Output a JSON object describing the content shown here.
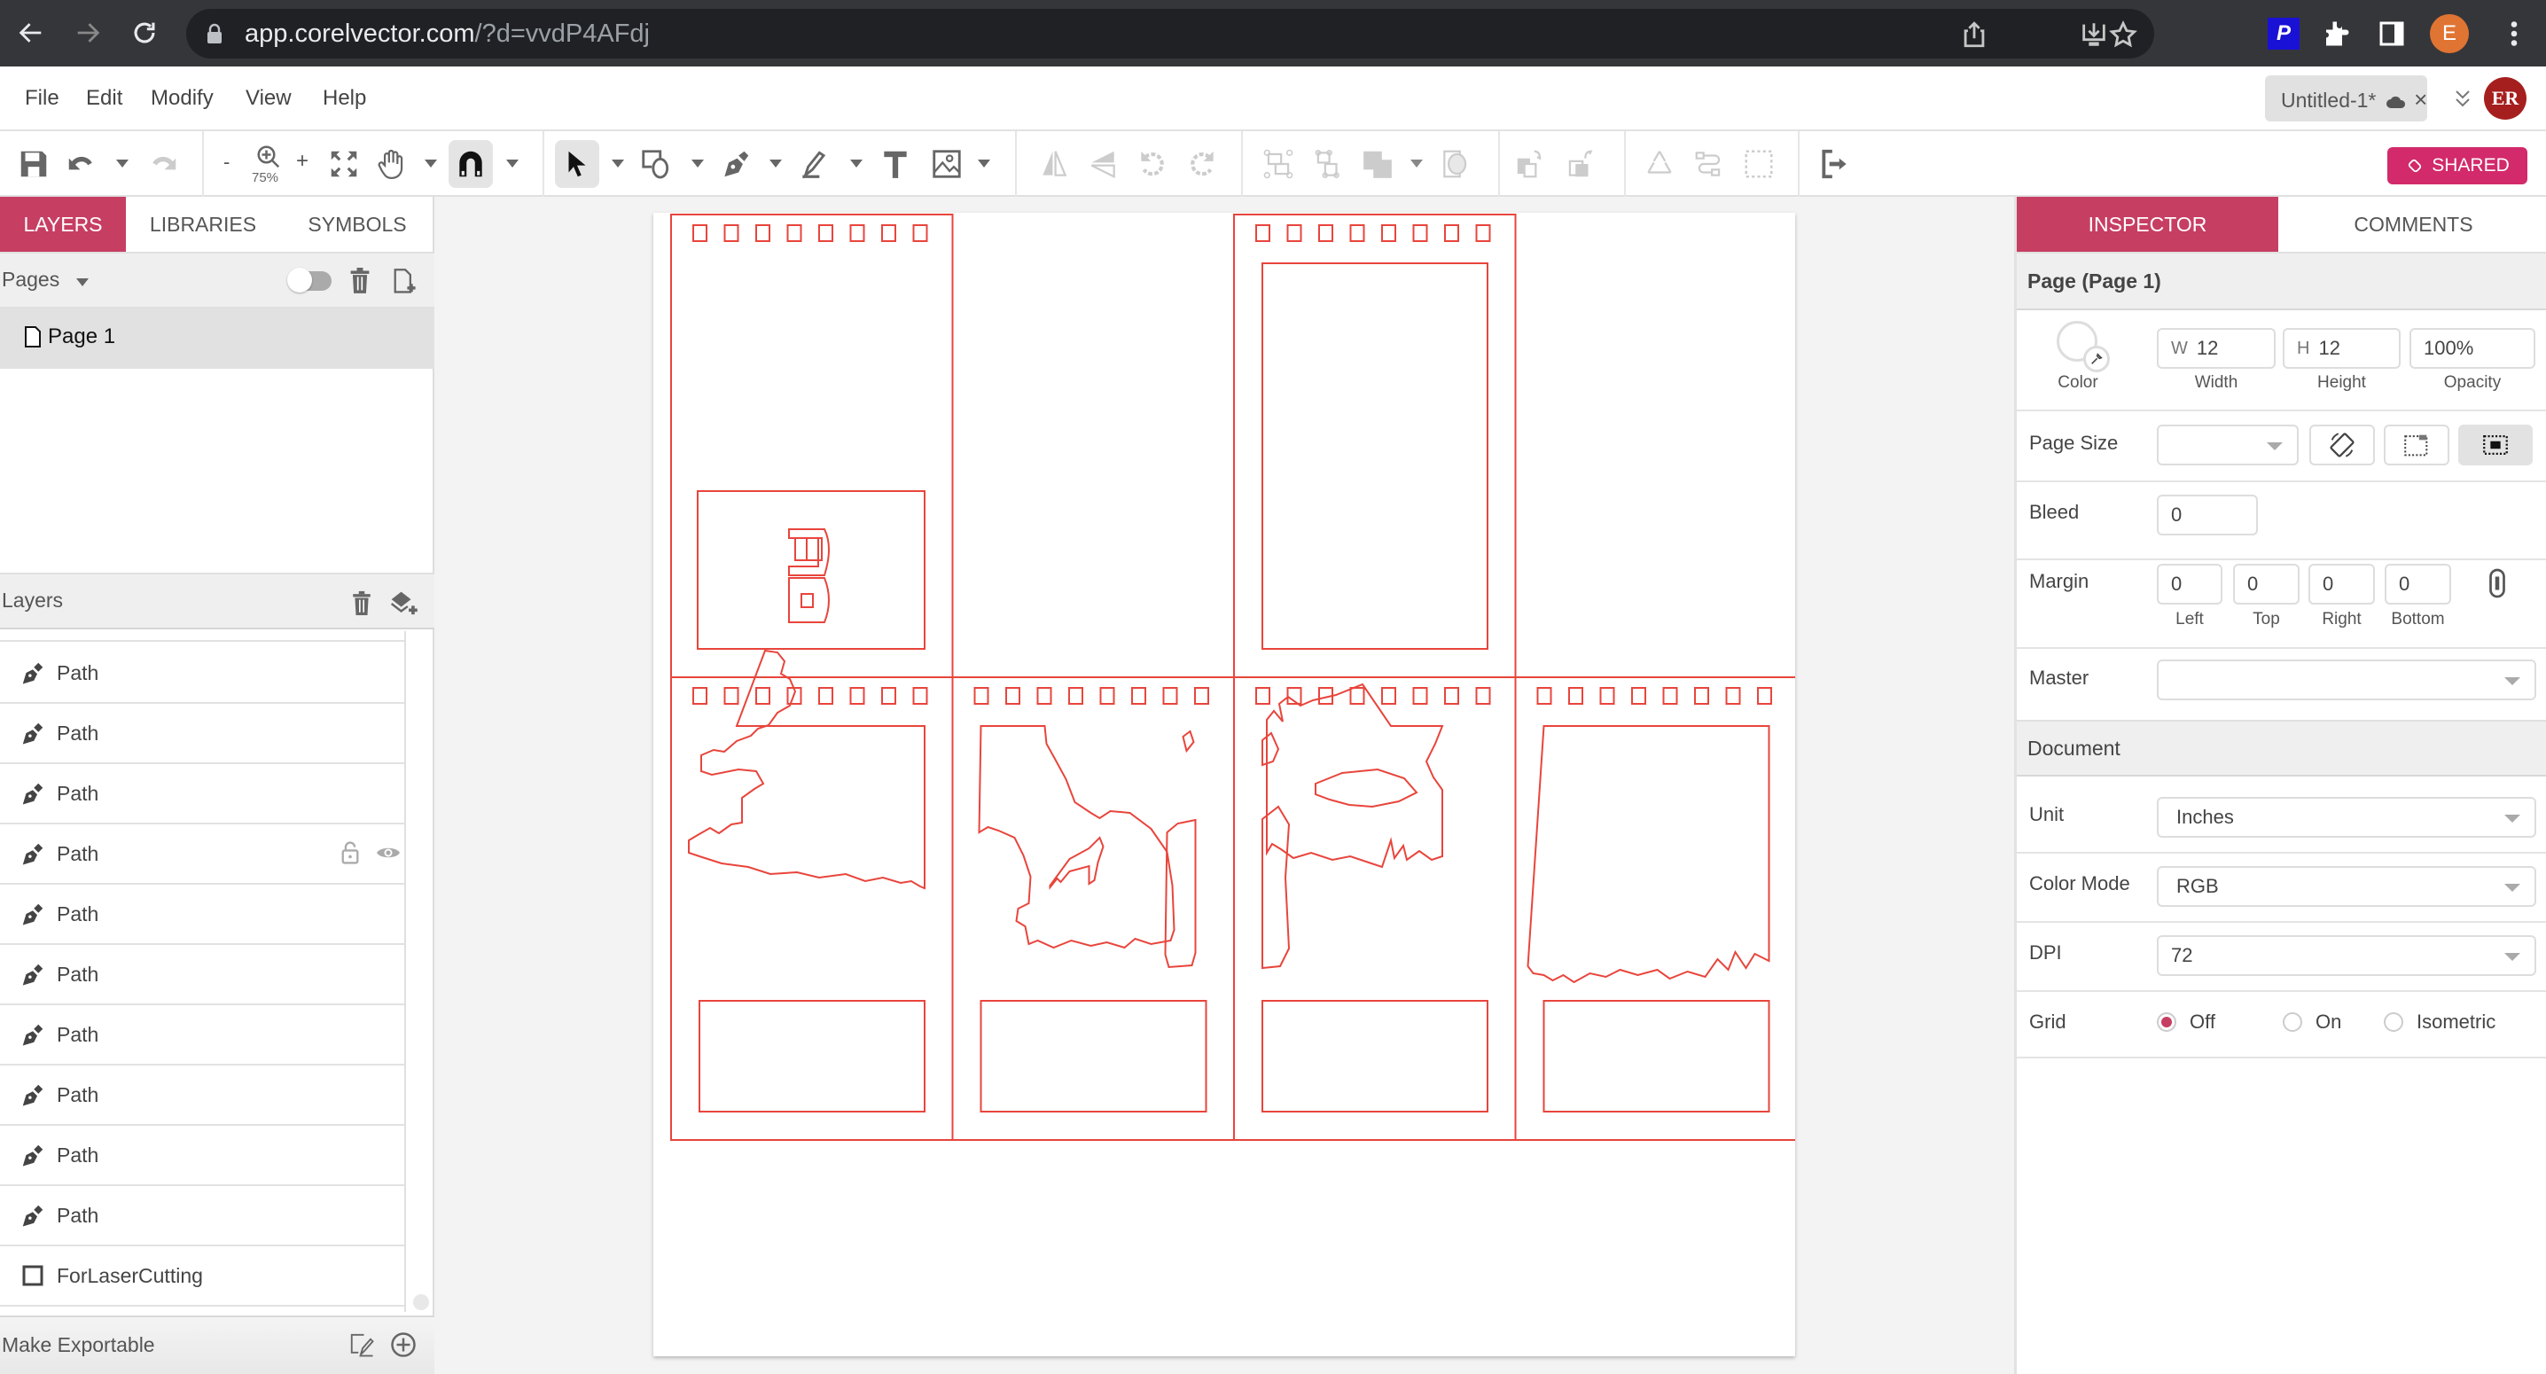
{
  "browser": {
    "url_host": "app.corelvector.com",
    "url_path": "/?d=vvdP4AFdj",
    "profile_initial": "E",
    "extension_p_label": "P"
  },
  "menu": {
    "items": [
      "File",
      "Edit",
      "Modify",
      "View",
      "Help"
    ]
  },
  "document_tab": {
    "title": "Untitled-1*",
    "close_glyph": "×"
  },
  "user": {
    "initials": "ER"
  },
  "toolbar": {
    "zoom_level": "75%",
    "zoom_out": "-",
    "zoom_in": "+",
    "shared_label": "SHARED"
  },
  "left_panel": {
    "tabs": [
      "LAYERS",
      "LIBRARIES",
      "SYMBOLS"
    ],
    "active_tab": "LAYERS",
    "pages_label": "Pages",
    "pages": [
      {
        "name": "Page 1",
        "selected": true
      }
    ],
    "layers_label": "Layers",
    "layers": [
      {
        "name": "Path",
        "type": "path"
      },
      {
        "name": "Path",
        "type": "path"
      },
      {
        "name": "Path",
        "type": "path"
      },
      {
        "name": "Path",
        "type": "path",
        "hovered": true
      },
      {
        "name": "Path",
        "type": "path"
      },
      {
        "name": "Path",
        "type": "path"
      },
      {
        "name": "Path",
        "type": "path"
      },
      {
        "name": "Path",
        "type": "path"
      },
      {
        "name": "Path",
        "type": "path"
      },
      {
        "name": "Path",
        "type": "path"
      },
      {
        "name": "ForLaserCutting",
        "type": "group"
      }
    ],
    "export_label": "Make Exportable"
  },
  "canvas": {
    "stroke_color": "#e8453c",
    "panels": 8
  },
  "inspector": {
    "tabs": [
      "INSPECTOR",
      "COMMENTS"
    ],
    "active_tab": "INSPECTOR",
    "page_section_title": "Page (Page 1)",
    "color_label": "Color",
    "width": {
      "prefix": "W",
      "value": "12",
      "label": "Width"
    },
    "height": {
      "prefix": "H",
      "value": "12",
      "label": "Height"
    },
    "opacity": {
      "value": "100%",
      "label": "Opacity"
    },
    "page_size_label": "Page Size",
    "page_size_value": "",
    "bleed_label": "Bleed",
    "bleed_value": "0",
    "margin_label": "Margin",
    "margins": [
      {
        "label": "Left",
        "value": "0"
      },
      {
        "label": "Top",
        "value": "0"
      },
      {
        "label": "Right",
        "value": "0"
      },
      {
        "label": "Bottom",
        "value": "0"
      }
    ],
    "master_label": "Master",
    "master_value": "",
    "document_section_title": "Document",
    "unit_label": "Unit",
    "unit_value": "Inches",
    "color_mode_label": "Color Mode",
    "color_mode_value": "RGB",
    "dpi_label": "DPI",
    "dpi_value": "72",
    "grid_label": "Grid",
    "grid_options": [
      "Off",
      "On",
      "Isometric"
    ],
    "grid_selected": "Off"
  },
  "colors": {
    "accent": "#c73e63",
    "shared_button": "#d22a6b",
    "avatar_er": "#a61f1f",
    "profile_avatar": "#e07432",
    "cut_line": "#e8453c"
  }
}
